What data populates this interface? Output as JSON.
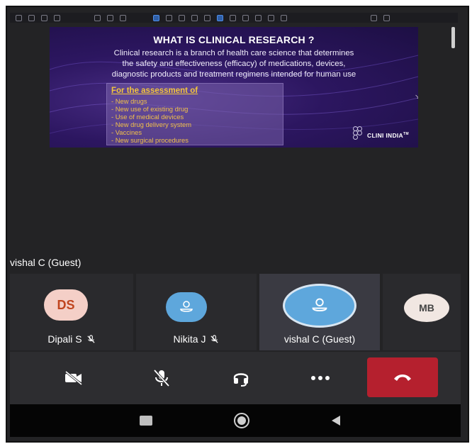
{
  "presentation": {
    "slide": {
      "title": "WHAT IS CLINICAL RESEARCH ?",
      "body_line_1": "Clinical research is a branch of health care science that determines",
      "body_line_2": "the safety and effectiveness  (efficacy) of medications, devices,",
      "body_line_3": "diagnostic products and treatment regimens intended for human use",
      "assessment_title": "For the assessment of",
      "assessment_items": [
        "New drugs",
        "New use of existing drug",
        "Use of medical devices",
        "New drug delivery system",
        "Vaccines",
        "New surgical procedures"
      ],
      "logo_text": "CLINI INDIA",
      "logo_tm": "TM"
    }
  },
  "active_speaker": {
    "name": "vishal C (Guest)"
  },
  "participants": [
    {
      "initials": "DS",
      "name": "Dipali S",
      "muted": true,
      "avatar": "initials"
    },
    {
      "initials": "",
      "name": "Nikita J",
      "muted": true,
      "avatar": "user-icon"
    },
    {
      "initials": "",
      "name": "vishal C (Guest)",
      "muted": false,
      "avatar": "user-icon",
      "active": true
    },
    {
      "initials": "MB",
      "name": "",
      "muted": false,
      "avatar": "initials"
    }
  ],
  "call_controls": {
    "buttons": [
      "camera-off-icon",
      "mic-off-icon",
      "headset-icon",
      "more-icon",
      "hang-up-icon"
    ]
  },
  "colors": {
    "hangup": "#b5202e",
    "avatar_user": "#5ea7dc",
    "avatar_ds_bg": "#f4cfc7",
    "avatar_ds_text": "#c0451f",
    "slide_bg": "#2c1660",
    "assessment_text": "#f3c53c"
  },
  "nav": {
    "buttons": [
      "recents-icon",
      "home-icon",
      "back-icon"
    ]
  }
}
